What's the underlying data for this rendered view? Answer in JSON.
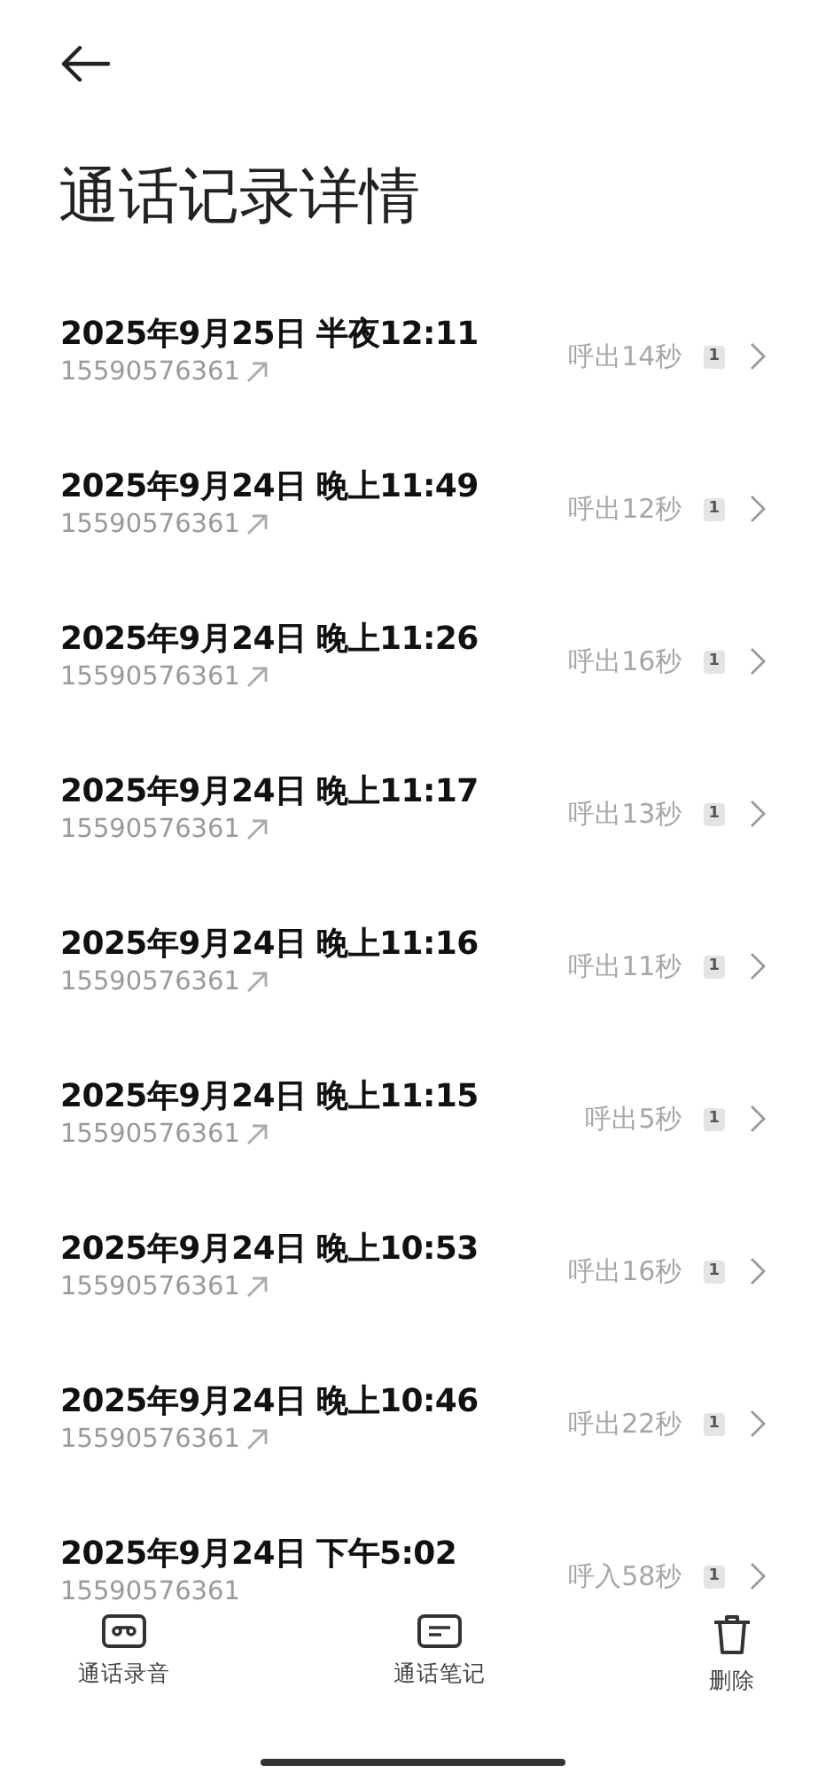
{
  "title": "通话记录详情",
  "calls": [
    {
      "datetime": "2025年9月25日 半夜12:11",
      "number": "15590576361",
      "outgoing": true,
      "duration": "呼出14秒",
      "sim": "1"
    },
    {
      "datetime": "2025年9月24日 晚上11:49",
      "number": "15590576361",
      "outgoing": true,
      "duration": "呼出12秒",
      "sim": "1"
    },
    {
      "datetime": "2025年9月24日 晚上11:26",
      "number": "15590576361",
      "outgoing": true,
      "duration": "呼出16秒",
      "sim": "1"
    },
    {
      "datetime": "2025年9月24日 晚上11:17",
      "number": "15590576361",
      "outgoing": true,
      "duration": "呼出13秒",
      "sim": "1"
    },
    {
      "datetime": "2025年9月24日 晚上11:16",
      "number": "15590576361",
      "outgoing": true,
      "duration": "呼出11秒",
      "sim": "1"
    },
    {
      "datetime": "2025年9月24日 晚上11:15",
      "number": "15590576361",
      "outgoing": true,
      "duration": "呼出5秒",
      "sim": "1"
    },
    {
      "datetime": "2025年9月24日 晚上10:53",
      "number": "15590576361",
      "outgoing": true,
      "duration": "呼出16秒",
      "sim": "1"
    },
    {
      "datetime": "2025年9月24日 晚上10:46",
      "number": "15590576361",
      "outgoing": true,
      "duration": "呼出22秒",
      "sim": "1"
    },
    {
      "datetime": "2025年9月24日 下午5:02",
      "number": "15590576361",
      "outgoing": false,
      "duration": "呼入58秒",
      "sim": "1"
    }
  ],
  "actions": [
    {
      "kind": "recording",
      "label": "通话录音"
    },
    {
      "kind": "notes",
      "label": "通话笔记"
    },
    {
      "kind": "delete",
      "label": "删除"
    }
  ]
}
